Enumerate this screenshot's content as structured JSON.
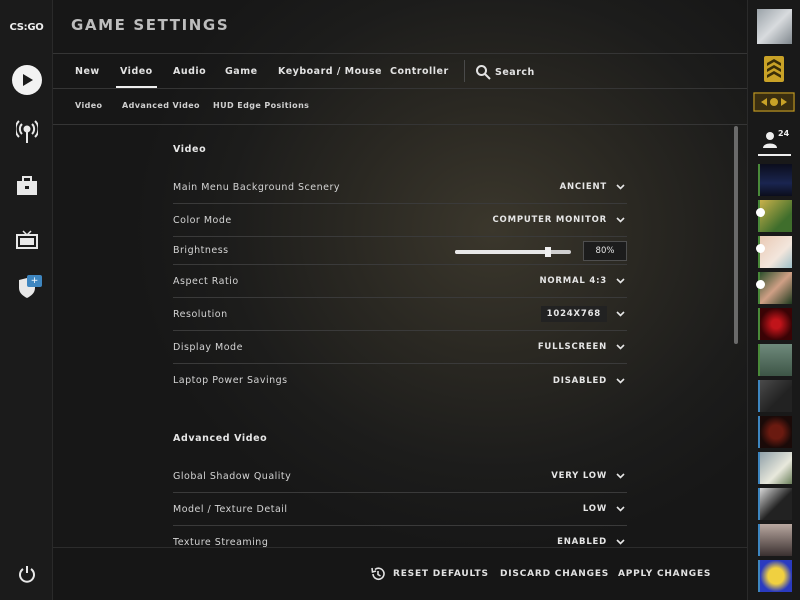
{
  "app": {
    "logo_text": "CS:GO"
  },
  "header": {
    "title": "GAME SETTINGS"
  },
  "tabs": [
    {
      "label": "New"
    },
    {
      "label": "Video",
      "active": true
    },
    {
      "label": "Audio"
    },
    {
      "label": "Game"
    },
    {
      "label": "Keyboard / Mouse"
    },
    {
      "label": "Controller"
    }
  ],
  "search": {
    "label": "Search"
  },
  "subtabs": [
    {
      "label": "Video"
    },
    {
      "label": "Advanced Video"
    },
    {
      "label": "HUD Edge Positions"
    }
  ],
  "sections": {
    "video": {
      "title": "Video",
      "rows": [
        {
          "label": "Main Menu Background Scenery",
          "value": "ANCIENT"
        },
        {
          "label": "Color Mode",
          "value": "COMPUTER MONITOR"
        },
        {
          "label": "Brightness",
          "value": "80%",
          "level": 0.8
        },
        {
          "label": "Aspect Ratio",
          "value": "NORMAL 4:3"
        },
        {
          "label": "Resolution",
          "value": "1024X768"
        },
        {
          "label": "Display Mode",
          "value": "FULLSCREEN"
        },
        {
          "label": "Laptop Power Savings",
          "value": "DISABLED"
        }
      ]
    },
    "advanced": {
      "title": "Advanced Video",
      "rows": [
        {
          "label": "Global Shadow Quality",
          "value": "VERY LOW"
        },
        {
          "label": "Model / Texture Detail",
          "value": "LOW"
        },
        {
          "label": "Texture Streaming",
          "value": "ENABLED"
        }
      ]
    }
  },
  "footer": {
    "reset": "RESET DEFAULTS",
    "discard": "DISCARD CHANGES",
    "apply": "APPLY CHANGES"
  },
  "friends": {
    "count": "24"
  },
  "colors": {
    "accent": "#3e86c0",
    "rank_gold": "#c9a227"
  },
  "icons": {
    "left": [
      "csgo-logo",
      "play-icon",
      "broadcast-icon",
      "briefcase-icon",
      "tv-icon",
      "shield-icon",
      "power-icon"
    ],
    "plus_badge": "+"
  }
}
